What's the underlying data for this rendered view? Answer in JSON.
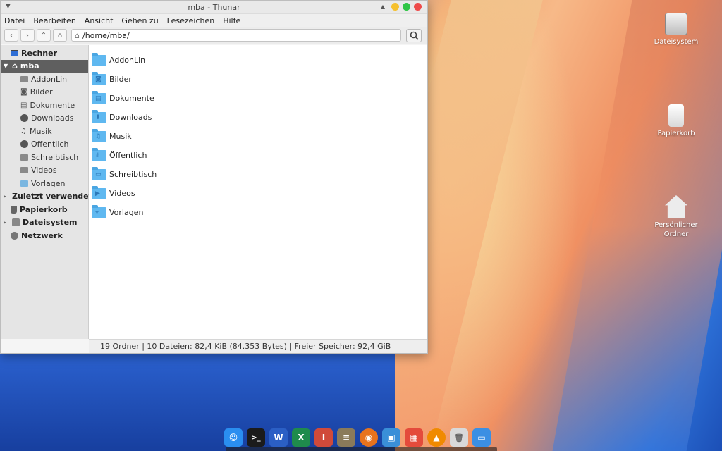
{
  "window": {
    "title": "mba - Thunar",
    "menu": [
      "Datei",
      "Bearbeiten",
      "Ansicht",
      "Gehen zu",
      "Lesezeichen",
      "Hilfe"
    ],
    "address": "/home/mba/"
  },
  "sidebar": {
    "items": [
      {
        "label": "Rechner",
        "icon": "monitor-icon"
      },
      {
        "label": "mba",
        "icon": "home-icon"
      },
      {
        "label": "AddonLin",
        "icon": "folder-icon"
      },
      {
        "label": "Bilder",
        "icon": "camera-icon"
      },
      {
        "label": "Dokumente",
        "icon": "document-icon"
      },
      {
        "label": "Downloads",
        "icon": "download-icon"
      },
      {
        "label": "Musik",
        "icon": "music-icon"
      },
      {
        "label": "Öffentlich",
        "icon": "public-icon"
      },
      {
        "label": "Schreibtisch",
        "icon": "desktop-icon"
      },
      {
        "label": "Videos",
        "icon": "video-icon"
      },
      {
        "label": "Vorlagen",
        "icon": "template-icon"
      },
      {
        "label": "Zuletzt verwendet",
        "icon": "recent-icon"
      },
      {
        "label": "Papierkorb",
        "icon": "trash-icon"
      },
      {
        "label": "Dateisystem",
        "icon": "harddisk-icon"
      },
      {
        "label": "Netzwerk",
        "icon": "network-icon"
      }
    ]
  },
  "files": [
    {
      "name": "AddonLin",
      "glyph": ""
    },
    {
      "name": "Bilder",
      "glyph": "◙"
    },
    {
      "name": "Dokumente",
      "glyph": "▤"
    },
    {
      "name": "Downloads",
      "glyph": "⬇"
    },
    {
      "name": "Musik",
      "glyph": "♫"
    },
    {
      "name": "Öffentlich",
      "glyph": "⋔"
    },
    {
      "name": "Schreibtisch",
      "glyph": "▭"
    },
    {
      "name": "Videos",
      "glyph": "▶"
    },
    {
      "name": "Vorlagen",
      "glyph": "⌖"
    }
  ],
  "status": "19 Ordner  |  10 Dateien: 82,4 KiB (84.353 Bytes)  |  Freier Speicher: 92,4 GiB",
  "desktop": {
    "icons": [
      {
        "label": "Dateisystem",
        "icon": "harddisk-icon"
      },
      {
        "label": "Papierkorb",
        "icon": "trash-icon"
      },
      {
        "label": "Persönlicher Ordner",
        "icon": "home-folder-icon"
      }
    ]
  },
  "dock": {
    "items": [
      {
        "name": "finder-icon",
        "glyph": "☺",
        "color": "#2a8ef0"
      },
      {
        "name": "terminal-icon",
        "glyph": ">_",
        "color": "#1b1b1b"
      },
      {
        "name": "word-icon",
        "glyph": "W",
        "color": "#2b5fc5"
      },
      {
        "name": "excel-icon",
        "glyph": "X",
        "color": "#1f8b4c"
      },
      {
        "name": "presentation-icon",
        "glyph": "I",
        "color": "#d04a3a"
      },
      {
        "name": "notes-icon",
        "glyph": "≡",
        "color": "#8a7a5a"
      },
      {
        "name": "firefox-icon",
        "glyph": "◉",
        "color": "#e8731d"
      },
      {
        "name": "image-viewer-icon",
        "glyph": "▣",
        "color": "#3a8fd8"
      },
      {
        "name": "calendar-icon",
        "glyph": "▦",
        "color": "#e44b3b"
      },
      {
        "name": "vlc-icon",
        "glyph": "▲",
        "color": "#f08a00"
      },
      {
        "name": "trash-icon",
        "glyph": "🗑",
        "color": "#d9d9d9"
      },
      {
        "name": "files-icon",
        "glyph": "▭",
        "color": "#3b8fe3"
      }
    ]
  }
}
